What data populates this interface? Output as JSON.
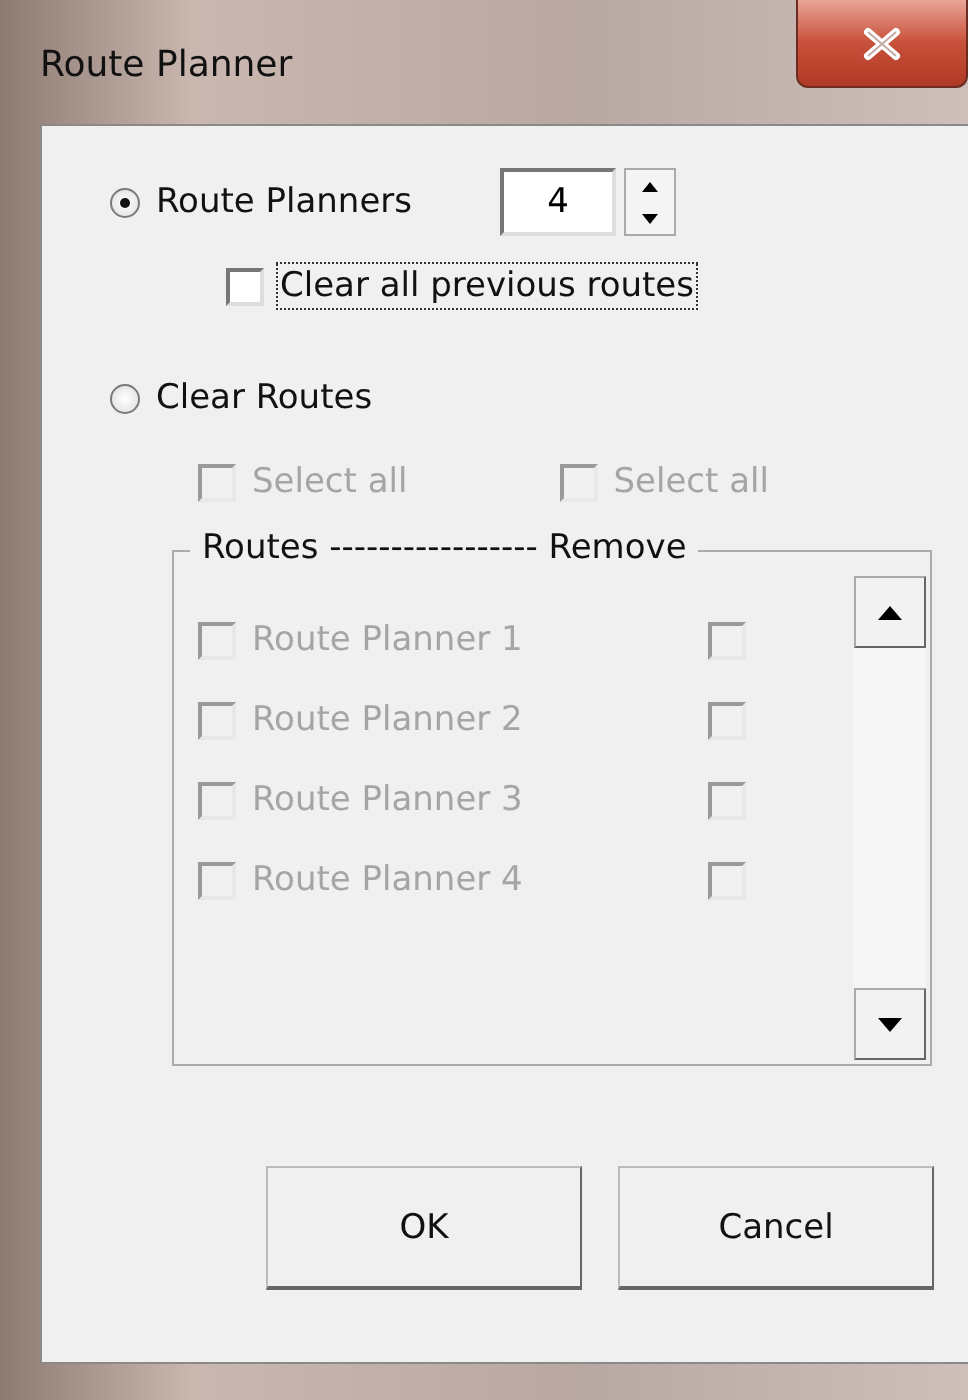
{
  "window": {
    "title": "Route Planner"
  },
  "route_planners": {
    "label": "Route Planners",
    "selected": true,
    "count": "4"
  },
  "clear_previous": {
    "label": "Clear all previous routes",
    "checked": false,
    "focused": true
  },
  "clear_routes": {
    "label": "Clear Routes",
    "selected": false
  },
  "select_all": [
    {
      "label": "Select all",
      "checked": false,
      "disabled": true
    },
    {
      "label": "Select all",
      "checked": false,
      "disabled": true
    }
  ],
  "routes_frame": {
    "legend": "Routes ----------------- Remove",
    "rows": [
      {
        "label": "Route Planner 1",
        "checked": false,
        "remove": false,
        "disabled": true
      },
      {
        "label": "Route Planner 2",
        "checked": false,
        "remove": false,
        "disabled": true
      },
      {
        "label": "Route Planner 3",
        "checked": false,
        "remove": false,
        "disabled": true
      },
      {
        "label": "Route Planner 4",
        "checked": false,
        "remove": false,
        "disabled": true
      }
    ]
  },
  "buttons": [
    "OK",
    "Cancel"
  ]
}
